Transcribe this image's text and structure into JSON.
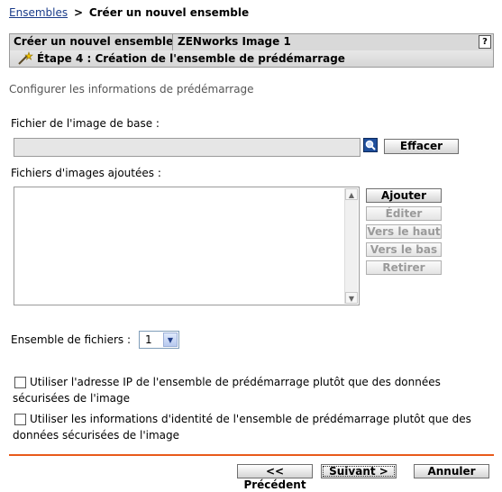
{
  "breadcrumb": {
    "link": "Ensembles",
    "separator": ">",
    "current": "Créer un nouvel ensemble"
  },
  "header": {
    "title": "Créer un nouvel ensemble",
    "bundle_type": "ZENworks Image 1",
    "help": "?",
    "step": "Étape 4 : Création de l'ensemble de prédémarrage"
  },
  "subtitle": "Configurer les informations de prédémarrage",
  "base_image": {
    "label": "Fichier de l'image de base :",
    "value": "",
    "clear_label": "Effacer"
  },
  "added_images": {
    "label": "Fichiers d'images ajoutées :",
    "items": [],
    "buttons": {
      "add": "Ajouter",
      "edit": "Éditer",
      "move_up": "Vers le haut",
      "move_down": "Vers le bas",
      "remove": "Retirer"
    }
  },
  "file_set": {
    "label": "Ensemble de fichiers :",
    "value": "1"
  },
  "checkboxes": [
    {
      "text": "Utiliser l'adresse IP de l'ensemble de prédémarrage plutôt que des données sécurisées de l'image",
      "checked": false
    },
    {
      "text": "Utiliser les informations d'identité de l'ensemble de prédémarrage plutôt que des données sécurisées de l'image",
      "checked": false
    }
  ],
  "footer": {
    "prev": "<< Précédent",
    "next": "Suivant >",
    "cancel": "Annuler"
  },
  "colors": {
    "accent_line": "#e85a1a",
    "link": "#1a3c8a"
  }
}
